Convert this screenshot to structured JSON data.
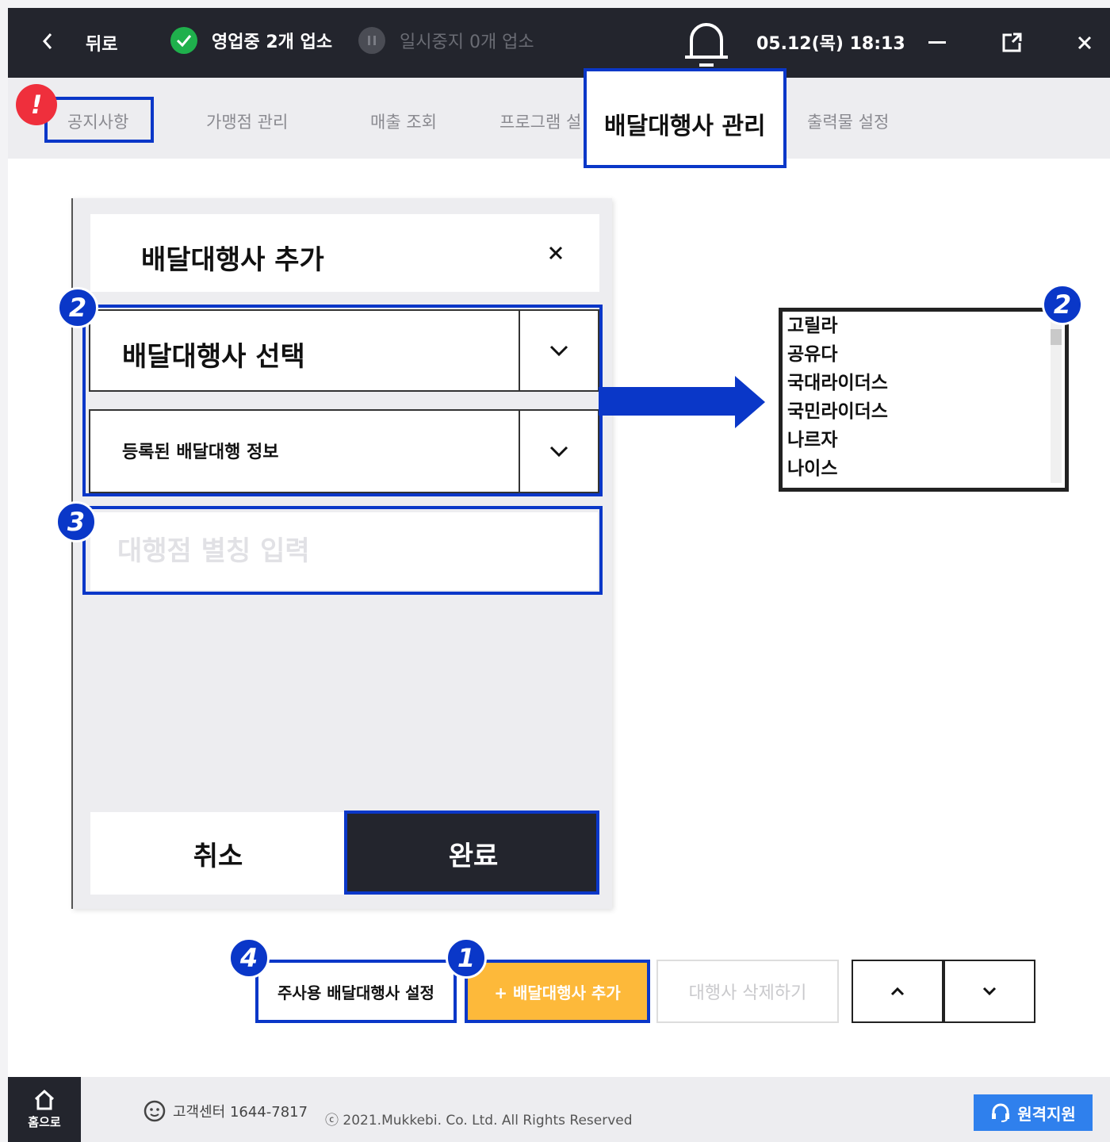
{
  "topbar": {
    "back_label": "뒤로",
    "open_status": "영업중 2개 업소",
    "pause_status": "일시중지 0개 업소",
    "datetime": "05.12(목) 18:13"
  },
  "tabs": [
    "공지사항",
    "가맹점 관리",
    "매출 조회",
    "프로그램 설",
    "배달대행사 관리",
    "출력물 설정"
  ],
  "active_tab": "배달대행사 관리",
  "alert_badge": "!",
  "panel": {
    "title": "배달대행사 추가",
    "select_label": "배달대행사 선택",
    "registered_label": "등록된 배달대행 정보",
    "alias_placeholder": "대행점 별칭 입력",
    "cancel_label": "취소",
    "done_label": "완료"
  },
  "dropdown_options": [
    "고릴라",
    "공유다",
    "국대라이더스",
    "국민라이더스",
    "나르자",
    "나이스"
  ],
  "badges": {
    "one": "1",
    "two": "2",
    "three": "3",
    "four": "4"
  },
  "actions": {
    "main_label": "주사용 배달대행사 설정",
    "add_label": "+ 배달대행사 추가",
    "delete_label": "대행사 삭제하기"
  },
  "footer": {
    "home_label": "홈으로",
    "support": "고객센터 1644-7817",
    "copyright": "ⓒ 2021.Mukkebi. Co. Ltd. All Rights Reserved",
    "remote_label": "원격지원"
  },
  "colors": {
    "highlight": "#0a37c8",
    "topbar": "#23252d",
    "add_button": "#fdb93a",
    "alert": "#ef2f3c",
    "remote": "#2f80ed",
    "open_status": "#1fb04c"
  }
}
